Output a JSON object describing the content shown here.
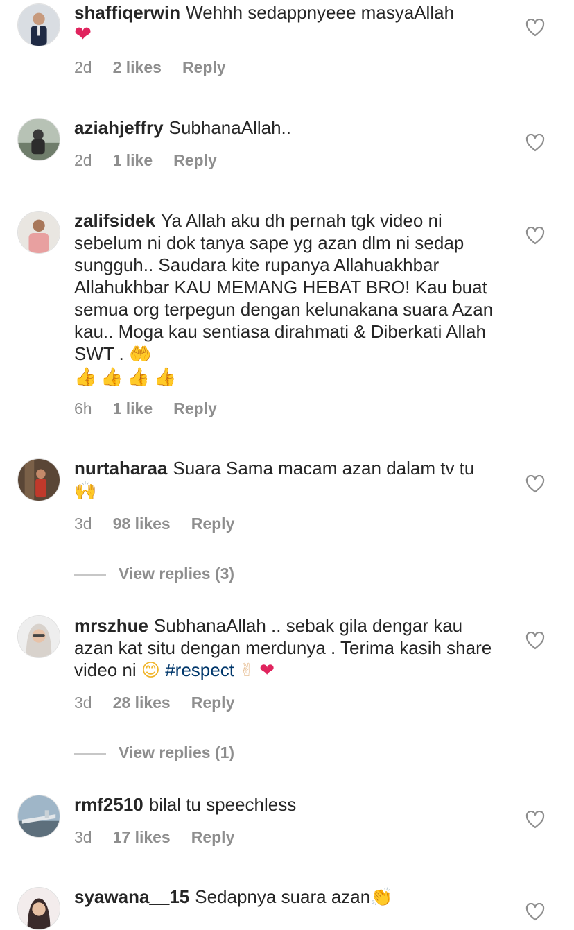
{
  "comments": [
    {
      "username": "shaffiqerwin",
      "text": "Wehhh sedappnyeee masyaAllah",
      "emoji": "❤",
      "time": "2d",
      "likes": "2 likes",
      "reply": "Reply"
    },
    {
      "username": "aziahjeffry",
      "text": "SubhanaAllah..",
      "time": "2d",
      "likes": "1 like",
      "reply": "Reply"
    },
    {
      "username": "zalifsidek",
      "text": "Ya Allah aku dh pernah tgk video ni sebelum ni dok tanya sape yg azan dlm ni sedap sungguh.. Saudara kite rupanya Allahuakhbar Allahukhbar KAU MEMANG HEBAT BRO! Kau buat semua org terpegun dengan kelunakana suara Azan kau.. Moga kau sentiasa dirahmati & Diberkati Allah SWT .",
      "emoji": "🤲",
      "emoji2": "👍👍👍👍",
      "time": "6h",
      "likes": "1 like",
      "reply": "Reply"
    },
    {
      "username": "nurtaharaa",
      "text": "Suara Sama macam azan dalam tv tu",
      "emoji": "🙌",
      "time": "3d",
      "likes": "98 likes",
      "reply": "Reply",
      "view_replies": "View replies (3)"
    },
    {
      "username": "mrszhue",
      "text": "SubhanaAllah .. sebak gila dengar kau azan kat situ dengan merdunya . Terima kasih share video ni",
      "emoji": "😊",
      "hashtag": "#respect",
      "emoji2": "✌",
      "emoji3": "❤",
      "time": "3d",
      "likes": "28 likes",
      "reply": "Reply",
      "view_replies": "View replies (1)"
    },
    {
      "username": "rmf2510",
      "text": "bilal tu speechless",
      "time": "3d",
      "likes": "17 likes",
      "reply": "Reply"
    },
    {
      "username": "syawana__15",
      "text": "Sedapnya suara azan",
      "emoji": "👏"
    }
  ],
  "icons": {
    "like": "heart-outline-icon"
  },
  "colors": {
    "text": "#262626",
    "meta": "#8e8e8e",
    "hashtag": "#00376b",
    "divider": "#c7c7c7"
  }
}
